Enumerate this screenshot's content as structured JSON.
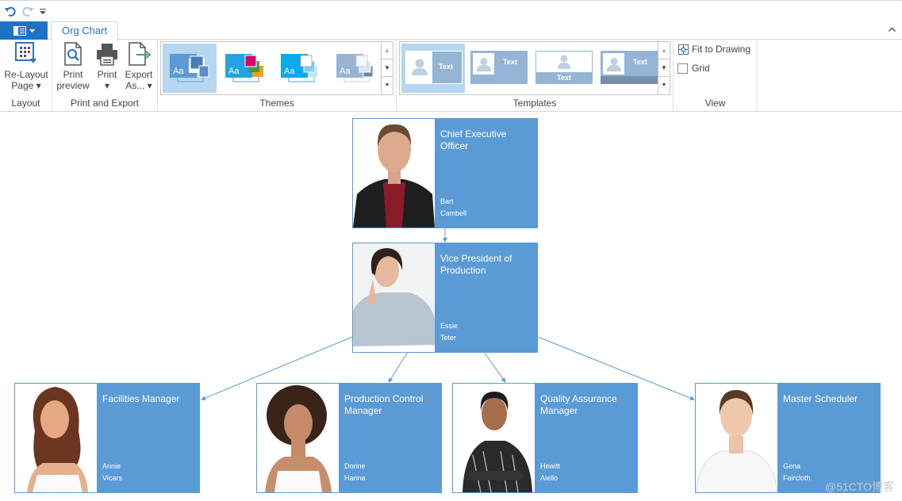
{
  "qat": {
    "icons": [
      "undo-icon",
      "redo-icon",
      "customize-icon"
    ]
  },
  "tabs": [
    {
      "label": "Org Chart",
      "active": true
    }
  ],
  "file_button": {
    "icon": "file-menu-icon"
  },
  "ribbon": {
    "layout": {
      "label": "Layout",
      "relayout": {
        "line1": "Re-Layout",
        "line2": "Page"
      }
    },
    "print_export": {
      "label": "Print and Export",
      "print_preview": {
        "line1": "Print",
        "line2": "preview"
      },
      "print": {
        "line1": "Print"
      },
      "export": {
        "line1": "Export",
        "line2": "As..."
      }
    },
    "themes": {
      "label": "Themes",
      "items": [
        "Theme 1",
        "Theme 2",
        "Theme 3",
        "Theme 4"
      ],
      "selected": 0
    },
    "templates": {
      "label": "Templates",
      "items": [
        "Text",
        "Text",
        "Text",
        "Text"
      ],
      "selected": 0
    },
    "view": {
      "label": "View",
      "fit_to_drawing": "Fit to Drawing",
      "grid": "Grid",
      "grid_checked": false
    }
  },
  "colors": {
    "accent": "#5b9bd5",
    "file_button": "#1e73c4",
    "tab_text": "#2b72c2"
  },
  "org": {
    "ceo": {
      "title": "Chief Executive Officer",
      "first": "Bart",
      "last": "Cambell"
    },
    "vp": {
      "title": "Vice President of Production",
      "first": "Essie",
      "last": "Teter"
    },
    "reports": [
      {
        "title": "Facilities Manager",
        "first": "Annie",
        "last": "Vicars"
      },
      {
        "title": "Production Control Manager",
        "first": "Dorine",
        "last": "Hanna"
      },
      {
        "title": "Quality Assurance Manager",
        "first": "Hewitt",
        "last": "Aiello"
      },
      {
        "title": "Master Scheduler",
        "first": "Gena",
        "last": "Faircloth"
      }
    ]
  },
  "watermark": "@51CTO博客"
}
